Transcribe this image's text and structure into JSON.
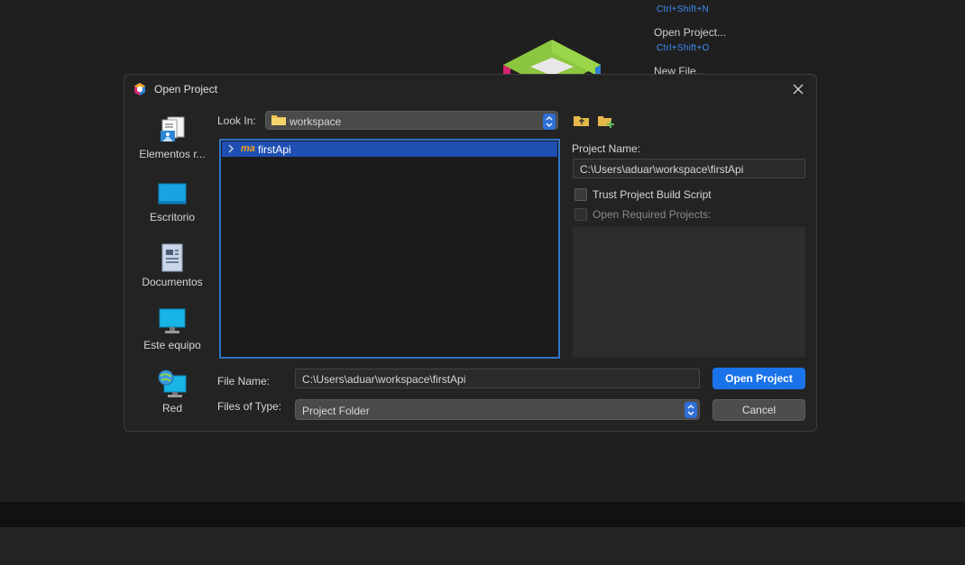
{
  "background": {
    "menu": {
      "new_project_shortcut": "Ctrl+Shift+N",
      "open_project_label": "Open Project...",
      "open_project_shortcut": "Ctrl+Shift+O",
      "new_file_label": "New File..."
    }
  },
  "dialog": {
    "title": "Open Project",
    "places": [
      {
        "label": "Elementos r...",
        "icon": "recent-items-icon"
      },
      {
        "label": "Escritorio",
        "icon": "desktop-icon"
      },
      {
        "label": "Documentos",
        "icon": "documents-icon"
      },
      {
        "label": "Este equipo",
        "icon": "computer-icon"
      },
      {
        "label": "Red",
        "icon": "network-icon"
      }
    ],
    "look_in_label": "Look In:",
    "look_in_value": "workspace",
    "files": [
      {
        "badge": "ma",
        "name": "firstApi",
        "selected": true
      }
    ],
    "project_name_label": "Project Name:",
    "project_name_value": "C:\\Users\\aduar\\workspace\\firstApi",
    "trust_build_label": "Trust Project Build Script",
    "open_required_label": "Open Required Projects:",
    "file_name_label": "File Name:",
    "file_name_value": "C:\\Users\\aduar\\workspace\\firstApi",
    "files_of_type_label": "Files of Type:",
    "files_of_type_value": "Project Folder",
    "open_button": "Open Project",
    "cancel_button": "Cancel"
  },
  "colors": {
    "accent": "#1a73e8",
    "selection": "#1f4fb3",
    "shortcut": "#3e8ef7"
  }
}
